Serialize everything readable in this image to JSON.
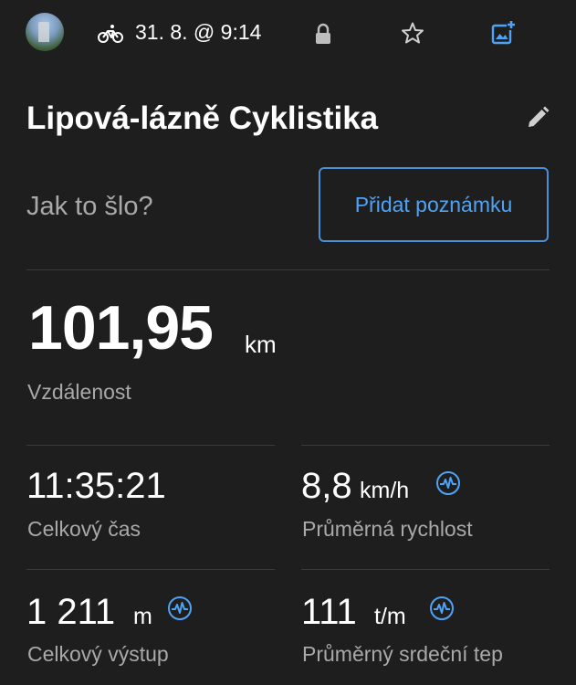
{
  "header": {
    "activity_icon": "bike-icon",
    "date_time": "31. 8. @ 9:14",
    "icons": [
      "lock-icon",
      "star-icon",
      "add-photo-icon"
    ],
    "accent_color": "#4a8fd6"
  },
  "activity": {
    "title": "Lipová-lázně Cyklistika",
    "prompt": "Jak to šlo?",
    "add_note_label": "Přidat poznámku"
  },
  "distance": {
    "value": "101,95",
    "unit": "km",
    "label": "Vzdálenost"
  },
  "stats": [
    {
      "value": "11:35:21",
      "unit": "",
      "label": "Celkový čas"
    },
    {
      "value": "8,8",
      "unit": "km/h",
      "label": "Průměrná rychlost",
      "icon": "pulse-icon"
    },
    {
      "value": "1 211",
      "unit": "m",
      "label": "Celkový výstup",
      "icon": "pulse-icon"
    },
    {
      "value": "111",
      "unit": "t/m",
      "label": "Průměrný srdeční tep",
      "icon": "pulse-icon"
    }
  ]
}
